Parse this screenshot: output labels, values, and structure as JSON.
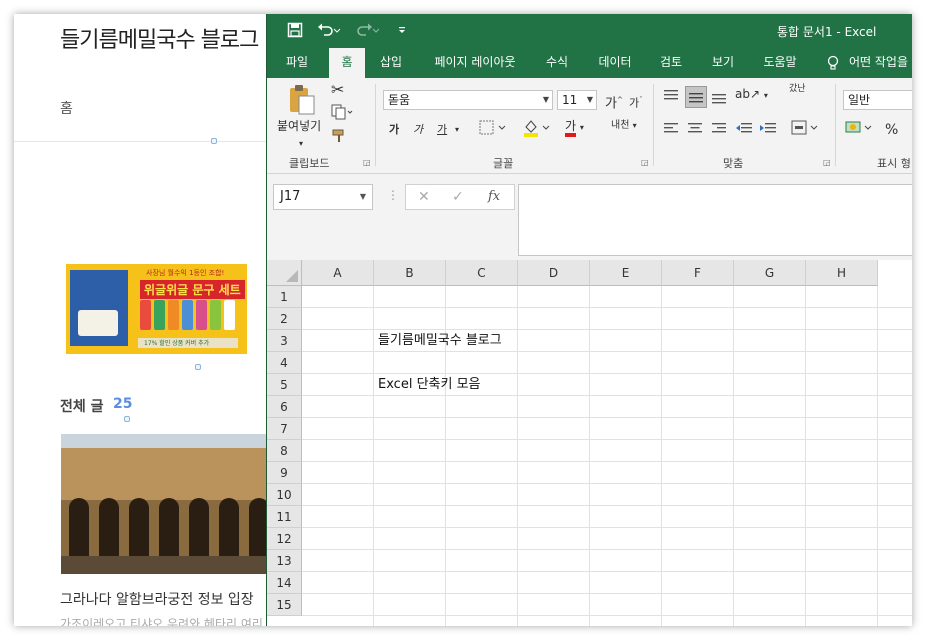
{
  "blog": {
    "title": "들기름메밀국수 블로그",
    "home_link": "홈",
    "post_count_label": "전체 글",
    "post_count": "25",
    "banner": {
      "tagline": "사장님 월수익 1등인 조합!",
      "headline": "위글위글 문구 세트",
      "strip": "17% 할인 상품 커버 추가"
    },
    "post_title": "그라나다 알함브라궁전 정보 입장",
    "post_excerpt": "가조이레오고 티샤오 우려와 헤타리 여리"
  },
  "excel": {
    "window_title": "통합 문서1  -  Excel",
    "quick_access": {
      "save_icon": "save-icon",
      "undo_icon": "undo-icon",
      "redo_icon": "redo-icon",
      "customize_icon": "customize-qat-icon"
    },
    "tabs": [
      {
        "label": "파일"
      },
      {
        "label": "홈"
      },
      {
        "label": "삽입"
      },
      {
        "label": "페이지 레이아웃"
      },
      {
        "label": "수식"
      },
      {
        "label": "데이터"
      },
      {
        "label": "검토"
      },
      {
        "label": "보기"
      },
      {
        "label": "도움말"
      },
      {
        "label": "어떤 작업을"
      }
    ],
    "active_tab": "홈",
    "ribbon": {
      "clipboard": {
        "group_label": "클립보드",
        "paste_label": "붙여넣기"
      },
      "font": {
        "group_label": "글꼴",
        "font_name": "돋움",
        "font_size": "11",
        "bold": "가",
        "italic": "가",
        "underline": "가",
        "font_color_glyph": "가",
        "phonetic": "내천"
      },
      "alignment": {
        "group_label": "맞춤",
        "wrap": "갔난"
      },
      "number": {
        "group_label": "표시 형",
        "format": "일반",
        "percent": "%"
      }
    },
    "name_box": "J17",
    "formula_bar_value": "",
    "columns": [
      "A",
      "B",
      "C",
      "D",
      "E",
      "F",
      "G",
      "H"
    ],
    "rows": [
      "1",
      "2",
      "3",
      "4",
      "5",
      "6",
      "7",
      "8",
      "9",
      "10",
      "11",
      "12",
      "13",
      "14",
      "15"
    ],
    "cells": [
      {
        "ref": "B3",
        "value": "들기름메밀국수 블로그"
      },
      {
        "ref": "B5",
        "value": "Excel 단축키 모음"
      }
    ],
    "colors": {
      "excel_green": "#217346",
      "ribbon_bg": "#f3f3f3",
      "header_bg": "#e6e6e6"
    }
  }
}
